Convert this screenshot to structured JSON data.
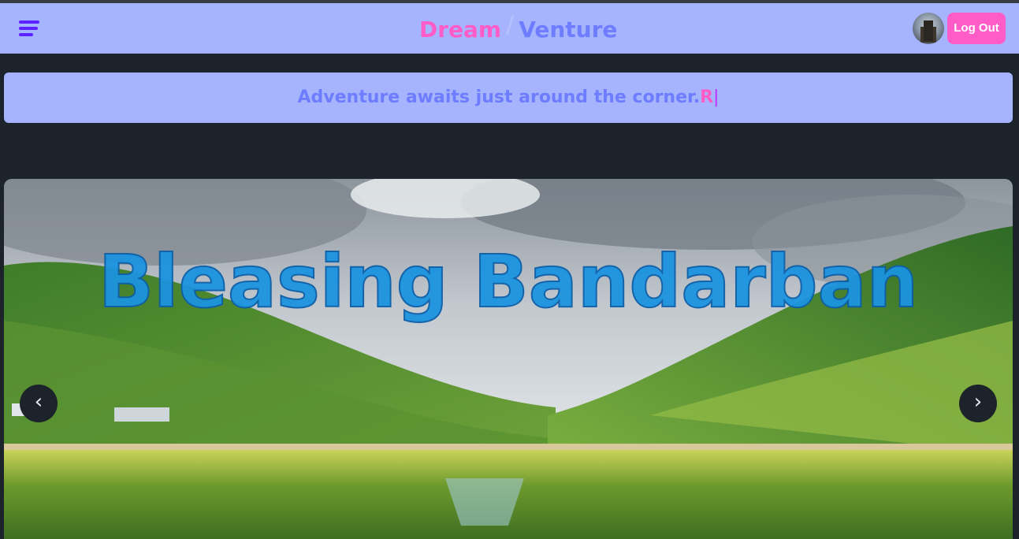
{
  "navbar": {
    "brand_part1": "Dream",
    "brand_separator": "/",
    "brand_part2": "Venture",
    "logout_label": "Log Out",
    "menu_icon": "hamburger-menu-icon",
    "avatar_icon": "user-avatar"
  },
  "banner": {
    "message": "Adventure awaits just around the corner.",
    "typed_text": "R",
    "cursor": "|"
  },
  "carousel": {
    "slide_title": "Bleasing Bandarban",
    "prev_symbol": "‹",
    "next_symbol": "›"
  },
  "colors": {
    "navbar_bg": "#a5b4fc",
    "page_bg": "#1d232a",
    "accent_pink": "#ff5cc8",
    "accent_indigo": "#6e7dff",
    "menu_purple": "#5b21ff"
  }
}
